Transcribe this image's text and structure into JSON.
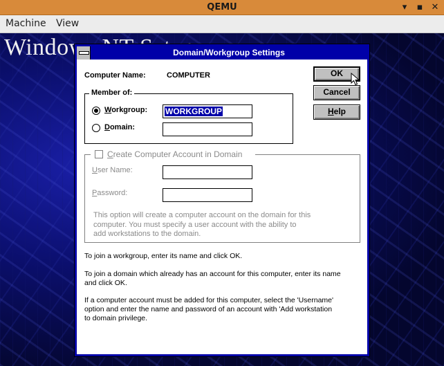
{
  "host": {
    "title": "QEMU",
    "menu": [
      "Machine",
      "View"
    ],
    "controls": {
      "minimize": "▾",
      "maximize": "▪",
      "close": "✕"
    }
  },
  "guest": {
    "splash_text": "Windows NT Setup"
  },
  "dialog": {
    "title": "Domain/Workgroup Settings",
    "computer_name_label": "Computer Name:",
    "computer_name_value": "COMPUTER",
    "member_of": {
      "caption": "Member of:",
      "workgroup_label_u": "W",
      "workgroup_label_rest": "orkgroup:",
      "workgroup_value": "WORKGROUP",
      "workgroup_selected": true,
      "domain_label_u": "D",
      "domain_label_rest": "omain:",
      "domain_value": ""
    },
    "create_account": {
      "caption_u": "C",
      "caption_rest": "reate Computer Account in Domain",
      "checked": false,
      "username_label_u": "U",
      "username_label_rest": "ser Name:",
      "username_value": "",
      "password_label_u": "P",
      "password_label_rest": "assword:",
      "password_value": "",
      "note_line1": "This option will create a computer account on the domain for this",
      "note_line2": "computer.  You must specify a user account with the ability to",
      "note_line3": "add workstations to the domain."
    },
    "buttons": {
      "ok": "OK",
      "cancel": "Cancel",
      "help_u": "H",
      "help_rest": "elp"
    },
    "help_text": {
      "p1": "To join a workgroup, enter its name and click OK.",
      "p2_line1": "To join a domain which already has an account for this computer, enter its name",
      "p2_line2": "and click OK.",
      "p3_line1": "If a computer account must be added for this computer, select the 'Username'",
      "p3_line2": "option and enter the name and password of an account with 'Add workstation",
      "p3_line3": "to domain privilege."
    }
  }
}
